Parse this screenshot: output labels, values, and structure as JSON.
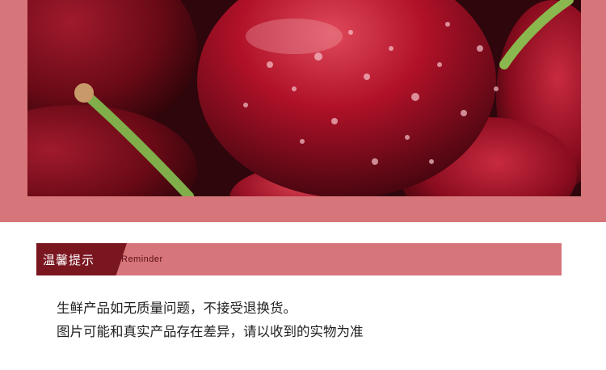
{
  "reminder": {
    "title_cn": "温馨提示",
    "title_en": "Reminder"
  },
  "notes": [
    "生鲜产品如无质量问题，不接受退换货。",
    "图片可能和真实产品存在差异，请以收到的实物为准"
  ],
  "colors": {
    "band": "#d6757a",
    "tag": "#7a1620",
    "text": "#222222"
  }
}
